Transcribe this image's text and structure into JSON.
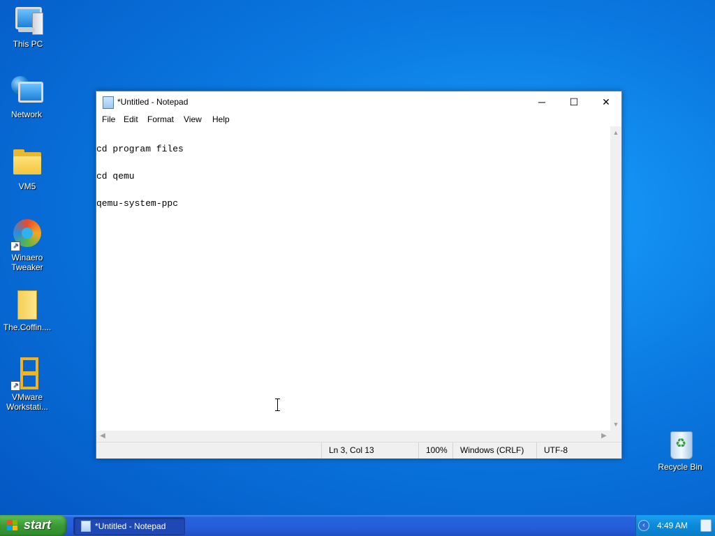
{
  "desktop": {
    "icons": [
      {
        "label": "This PC"
      },
      {
        "label": "Network"
      },
      {
        "label": "VM5"
      },
      {
        "label": "Winaero Tweaker"
      },
      {
        "label": "The.Coffin...."
      },
      {
        "label": "VMware Workstati..."
      },
      {
        "label": "Recycle Bin"
      }
    ]
  },
  "notepad": {
    "title": "*Untitled - Notepad",
    "controls": {
      "minimize": "─",
      "maximize": "☐",
      "close": "✕"
    },
    "menu": [
      "File",
      "Edit",
      "Format",
      "View",
      "Help"
    ],
    "lines": [
      "cd program files",
      "cd qemu",
      "qemu-system-ppc"
    ],
    "status": {
      "position": "Ln 3, Col 13",
      "zoom": "100%",
      "line_endings": "Windows (CRLF)",
      "encoding": "UTF-8"
    }
  },
  "taskbar": {
    "start_label": "start",
    "task": "*Untitled - Notepad",
    "clock": "4:49 AM"
  },
  "colors": {
    "desktop_bg": "#0a78e0",
    "taskbar_bg": "#245edb",
    "start_green": "#3a9a35"
  }
}
